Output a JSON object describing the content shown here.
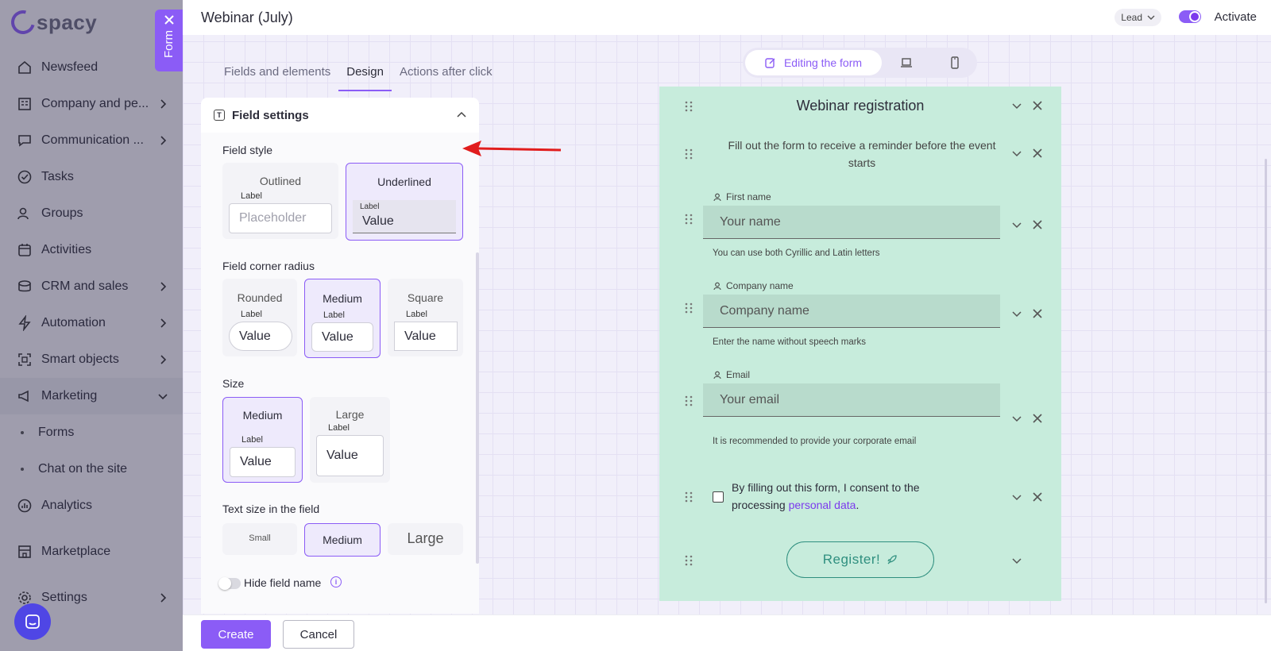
{
  "app": {
    "brand": "spacy",
    "nav": [
      {
        "label": "Newsfeed",
        "icon": "home-icon",
        "chevron": false
      },
      {
        "label": "Company and pe...",
        "icon": "building-icon",
        "chevron": true
      },
      {
        "label": "Communication ...",
        "icon": "chat-icon",
        "chevron": true
      },
      {
        "label": "Tasks",
        "icon": "check-circle-icon",
        "chevron": false
      },
      {
        "label": "Groups",
        "icon": "users-icon",
        "chevron": false
      },
      {
        "label": "Activities",
        "icon": "calendar-icon",
        "chevron": false
      },
      {
        "label": "CRM and sales",
        "icon": "coins-icon",
        "chevron": true
      },
      {
        "label": "Automation",
        "icon": "lightning-icon",
        "chevron": true
      },
      {
        "label": "Smart objects",
        "icon": "scan-icon",
        "chevron": true
      },
      {
        "label": "Marketing",
        "icon": "megaphone-icon",
        "chevron": true,
        "open": true
      }
    ],
    "marketing_sub": [
      "Forms",
      "Chat on the site"
    ],
    "nav_bottom": [
      {
        "label": "Analytics",
        "icon": "chart-icon",
        "chevron": false
      },
      {
        "label": "Marketplace",
        "icon": "store-icon",
        "chevron": false
      },
      {
        "label": "Settings",
        "icon": "gear-icon",
        "chevron": true
      }
    ]
  },
  "form_tab": {
    "label": "Form"
  },
  "header": {
    "title": "Webinar (July)",
    "entity": "Lead",
    "activate_label": "Activate"
  },
  "tabs": [
    {
      "label": "Fields and elements",
      "active": false
    },
    {
      "label": "Design",
      "active": true
    },
    {
      "label": "Actions after click",
      "active": false
    }
  ],
  "settings": {
    "title": "Field settings",
    "field_style": {
      "label": "Field style",
      "options": [
        {
          "title": "Outlined",
          "mini_label": "Label",
          "mini_value": "Placeholder",
          "selected": false
        },
        {
          "title": "Underlined",
          "mini_label": "Label",
          "mini_value": "Value",
          "selected": true
        }
      ]
    },
    "corner_radius": {
      "label": "Field corner radius",
      "options": [
        {
          "title": "Rounded",
          "mini_label": "Label",
          "mini_value": "Value",
          "selected": false
        },
        {
          "title": "Medium",
          "mini_label": "Label",
          "mini_value": "Value",
          "selected": true
        },
        {
          "title": "Square",
          "mini_label": "Label",
          "mini_value": "Value",
          "selected": false
        }
      ]
    },
    "size": {
      "label": "Size",
      "options": [
        {
          "title": "Medium",
          "mini_label": "Label",
          "mini_value": "Value",
          "selected": true
        },
        {
          "title": "Large",
          "mini_label": "Label",
          "mini_value": "Value",
          "selected": false
        }
      ]
    },
    "text_size": {
      "label": "Text size in the field",
      "options": [
        {
          "title": "Small",
          "selected": false
        },
        {
          "title": "Medium",
          "selected": true
        },
        {
          "title": "Large",
          "selected": false
        }
      ]
    },
    "hide_field_name": {
      "label": "Hide field name",
      "enabled": false
    }
  },
  "view_switch": {
    "active_label": "Editing the form"
  },
  "preview": {
    "title": "Webinar registration",
    "subtitle": "Fill out the form to receive a reminder before the event starts",
    "fields": [
      {
        "label": "First name",
        "placeholder": "Your name",
        "hint": "You can use both Cyrillic and Latin letters"
      },
      {
        "label": "Company name",
        "placeholder": "Company name",
        "hint": "Enter the name without speech marks"
      },
      {
        "label": "Email",
        "placeholder": "Your email",
        "hint": "It is recommended to provide your corporate email"
      }
    ],
    "consent_text": "By filling out this form, I consent to the processing ",
    "consent_link": "personal data",
    "consent_end": ".",
    "button_label": "Register!"
  },
  "footer": {
    "create_label": "Create",
    "cancel_label": "Cancel"
  },
  "colors": {
    "accent": "#8b5cf6",
    "preview_bg": "#c7ecdc",
    "button_border": "#2f8f7f",
    "annotation_arrow": "#e11d1d"
  }
}
